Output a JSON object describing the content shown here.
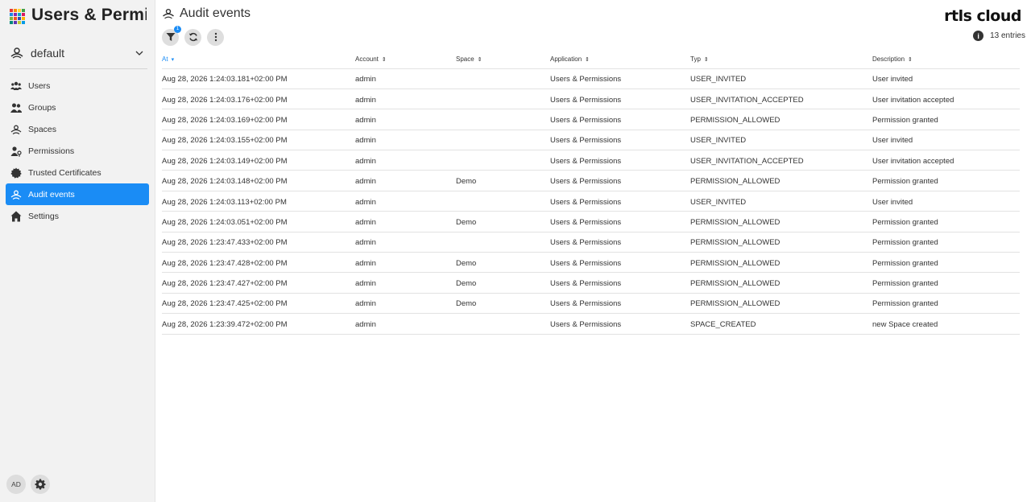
{
  "app": {
    "title": "Users & Permi...",
    "brand": "rtls cloud"
  },
  "space_selector": {
    "value": "default"
  },
  "sidebar": {
    "items": [
      {
        "label": "Users",
        "icon": "users-icon",
        "active": false
      },
      {
        "label": "Groups",
        "icon": "groups-icon",
        "active": false
      },
      {
        "label": "Spaces",
        "icon": "spaces-icon",
        "active": false
      },
      {
        "label": "Permissions",
        "icon": "permissions-icon",
        "active": false
      },
      {
        "label": "Trusted Certificates",
        "icon": "certificate-icon",
        "active": false
      },
      {
        "label": "Audit events",
        "icon": "audit-icon",
        "active": true
      },
      {
        "label": "Settings",
        "icon": "settings-home-icon",
        "active": false
      }
    ],
    "user_initials": "AD"
  },
  "page": {
    "title": "Audit events",
    "entries_label": "13 entries",
    "filter_badge": "1"
  },
  "table": {
    "columns": [
      "At",
      "Account",
      "Space",
      "Application",
      "Typ",
      "Description"
    ],
    "sorted_column": "At",
    "rows": [
      [
        "Aug 28, 2026 1:24:03.181+02:00 PM",
        "admin",
        "",
        "Users & Permissions",
        "USER_INVITED",
        "User invited"
      ],
      [
        "Aug 28, 2026 1:24:03.176+02:00 PM",
        "admin",
        "",
        "Users & Permissions",
        "USER_INVITATION_ACCEPTED",
        "User invitation accepted"
      ],
      [
        "Aug 28, 2026 1:24:03.169+02:00 PM",
        "admin",
        "",
        "Users & Permissions",
        "PERMISSION_ALLOWED",
        "Permission granted"
      ],
      [
        "Aug 28, 2026 1:24:03.155+02:00 PM",
        "admin",
        "",
        "Users & Permissions",
        "USER_INVITED",
        "User invited"
      ],
      [
        "Aug 28, 2026 1:24:03.149+02:00 PM",
        "admin",
        "",
        "Users & Permissions",
        "USER_INVITATION_ACCEPTED",
        "User invitation accepted"
      ],
      [
        "Aug 28, 2026 1:24:03.148+02:00 PM",
        "admin",
        "Demo",
        "Users & Permissions",
        "PERMISSION_ALLOWED",
        "Permission granted"
      ],
      [
        "Aug 28, 2026 1:24:03.113+02:00 PM",
        "admin",
        "",
        "Users & Permissions",
        "USER_INVITED",
        "User invited"
      ],
      [
        "Aug 28, 2026 1:24:03.051+02:00 PM",
        "admin",
        "Demo",
        "Users & Permissions",
        "PERMISSION_ALLOWED",
        "Permission granted"
      ],
      [
        "Aug 28, 2026 1:23:47.433+02:00 PM",
        "admin",
        "",
        "Users & Permissions",
        "PERMISSION_ALLOWED",
        "Permission granted"
      ],
      [
        "Aug 28, 2026 1:23:47.428+02:00 PM",
        "admin",
        "Demo",
        "Users & Permissions",
        "PERMISSION_ALLOWED",
        "Permission granted"
      ],
      [
        "Aug 28, 2026 1:23:47.427+02:00 PM",
        "admin",
        "Demo",
        "Users & Permissions",
        "PERMISSION_ALLOWED",
        "Permission granted"
      ],
      [
        "Aug 28, 2026 1:23:47.425+02:00 PM",
        "admin",
        "Demo",
        "Users & Permissions",
        "PERMISSION_ALLOWED",
        "Permission granted"
      ],
      [
        "Aug 28, 2026 1:23:39.472+02:00 PM",
        "admin",
        "",
        "Users & Permissions",
        "SPACE_CREATED",
        "new Space created"
      ]
    ]
  },
  "colors": {
    "accent": "#1a8cf5",
    "sidebar_bg": "#f2f2f2",
    "logo": [
      "#e53935",
      "#fb8c00",
      "#fdd835",
      "#43a047",
      "#1e88e5",
      "#8e24aa",
      "#00acc1",
      "#d81b60",
      "#7cb342",
      "#f4511e",
      "#3949ab",
      "#ffb300",
      "#00897b",
      "#5e35b1",
      "#c0ca33",
      "#039be5"
    ]
  }
}
